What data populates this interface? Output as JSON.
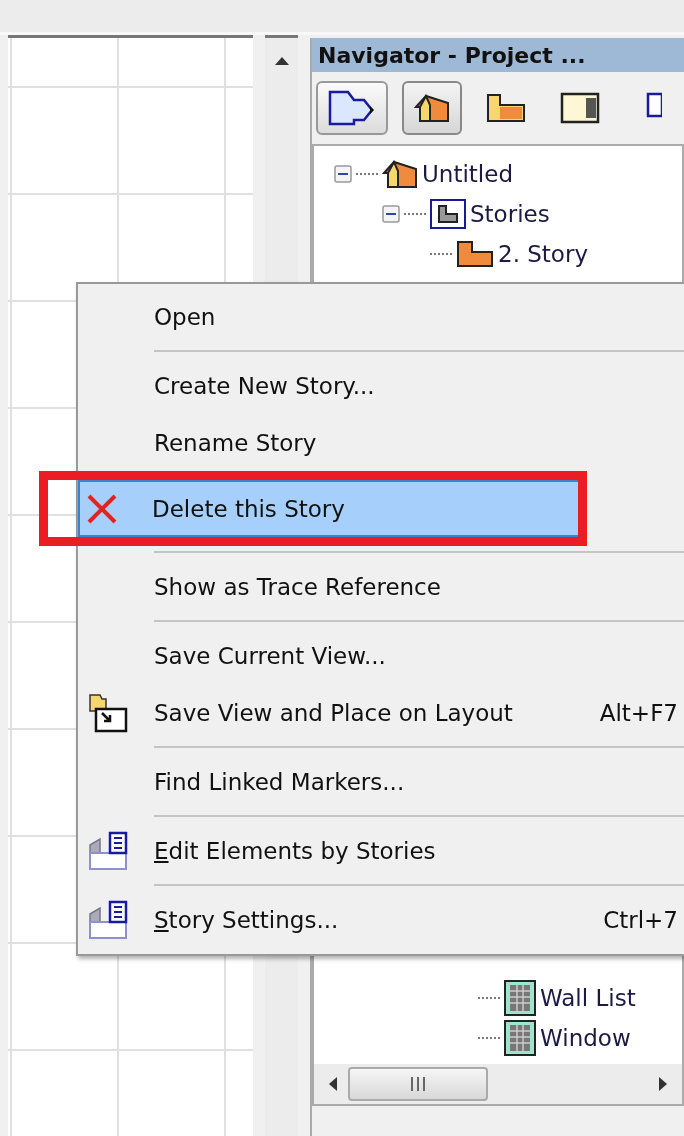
{
  "navigator": {
    "title": "Navigator - Project ...",
    "tools": [
      {
        "kind": "publish",
        "selected": false
      },
      {
        "kind": "project",
        "selected": true
      },
      {
        "kind": "view",
        "selected": false
      },
      {
        "kind": "layout",
        "selected": false
      },
      {
        "kind": "publisher",
        "selected": false
      }
    ],
    "tree": [
      {
        "label": "Untitled",
        "kind": "project",
        "expanded": true,
        "children": [
          {
            "label": "Stories",
            "kind": "stories",
            "expanded": true,
            "children": [
              {
                "label": "2. Story",
                "kind": "story"
              }
            ]
          }
        ]
      }
    ],
    "tree_lower": [
      {
        "label": "Wall List",
        "kind": "list"
      },
      {
        "label": "Window",
        "kind": "list"
      }
    ]
  },
  "context_menu": {
    "groups": [
      [
        {
          "label": "Open",
          "selected": false
        }
      ],
      [
        {
          "label": "Create New Story...",
          "selected": false
        },
        {
          "label": "Rename Story",
          "selected": false
        },
        {
          "label": "Delete this Story",
          "selected": true,
          "kind": "delete",
          "highlighted_by_frame": true
        }
      ],
      [
        {
          "label": "Show as Trace Reference",
          "selected": false
        }
      ],
      [
        {
          "label": "Save Current View...",
          "selected": false
        },
        {
          "label": "Save View and Place on Layout",
          "selected": false,
          "kind": "place",
          "shortcut": "Alt+F7"
        }
      ],
      [
        {
          "label": "Find Linked Markers...",
          "selected": false
        }
      ],
      [
        {
          "label": "Edit Elements by Stories",
          "selected": false,
          "kind": "stories",
          "underline_first": true
        }
      ],
      [
        {
          "label": "Story Settings...",
          "selected": false,
          "kind": "stories",
          "underline_first": true,
          "shortcut": "Ctrl+7"
        }
      ]
    ]
  }
}
